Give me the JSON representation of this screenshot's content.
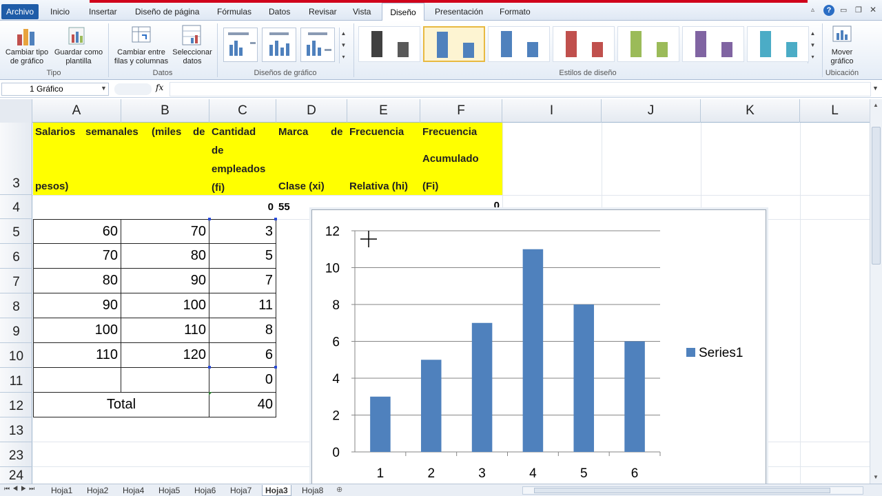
{
  "menu": {
    "archivo": "Archivo",
    "items": [
      "Inicio",
      "Insertar",
      "Diseño de página",
      "Fórmulas",
      "Datos",
      "Revisar",
      "Vista"
    ],
    "active": "Diseño",
    "after": [
      "Presentación",
      "Formato"
    ]
  },
  "ribbon": {
    "tipo": {
      "btn1": "Cambiar tipo de gráfico",
      "btn2": "Guardar como plantilla",
      "label": "Tipo"
    },
    "datos": {
      "btn1": "Cambiar entre filas y columnas",
      "btn2": "Seleccionar datos",
      "label": "Datos"
    },
    "disenos_label": "Diseños de gráfico",
    "estilos_label": "Estilos de diseño",
    "style_colors": [
      "#404040",
      "#4f81bd",
      "#4f81bd",
      "#c0504d",
      "#9bbb59",
      "#8064a2",
      "#4bacc6"
    ],
    "ubicacion": {
      "btn": "Mover gráfico",
      "label": "Ubicación"
    }
  },
  "formula": {
    "namebox": "1 Gráfico",
    "fx": "fx",
    "content": ""
  },
  "columns": [
    "A",
    "B",
    "C",
    "D",
    "E",
    "F",
    "I",
    "J",
    "K",
    "L"
  ],
  "rows": [
    "3",
    "4",
    "5",
    "6",
    "7",
    "8",
    "9",
    "10",
    "11",
    "12",
    "13",
    "23",
    "24"
  ],
  "headers": {
    "a_line1": "Salarios",
    "a_line1b": "semanales",
    "a_line1c": "(miles",
    "a_line1d": "de",
    "a_line2": "pesos)",
    "c_line1": "Cantidad",
    "c_line2": "de",
    "c_line3": "empleados",
    "c_line4": "(fi)",
    "d_line1": "Marca",
    "d_line1b": "de",
    "d_line2": "Clase (xi)",
    "e_line1": "Frecuencia",
    "e_line2": "Relativa (hi)",
    "f_line1": "Frecuencia",
    "f_line2": "Acumulado",
    "f_line3": "(Fi)"
  },
  "row4": {
    "c": "0",
    "d": "55",
    "f": "0"
  },
  "table": [
    {
      "a": "60",
      "b": "70",
      "c": "3"
    },
    {
      "a": "70",
      "b": "80",
      "c": "5"
    },
    {
      "a": "80",
      "b": "90",
      "c": "7"
    },
    {
      "a": "90",
      "b": "100",
      "c": "11"
    },
    {
      "a": "100",
      "b": "110",
      "c": "8"
    },
    {
      "a": "110",
      "b": "120",
      "c": "6"
    }
  ],
  "row11": {
    "c": "0"
  },
  "total": {
    "label": "Total",
    "value": "40"
  },
  "chart_data": {
    "type": "bar",
    "categories": [
      "1",
      "2",
      "3",
      "4",
      "5",
      "6"
    ],
    "series": [
      {
        "name": "Series1",
        "values": [
          3,
          5,
          7,
          11,
          8,
          6
        ],
        "color": "#4f81bd"
      }
    ],
    "ylim": [
      0,
      12
    ],
    "yticks": [
      "0",
      "2",
      "4",
      "6",
      "8",
      "10",
      "12"
    ],
    "grid": true,
    "legend": "right"
  },
  "sheets": [
    "Hoja1",
    "Hoja2",
    "Hoja4",
    "Hoja5",
    "Hoja6",
    "Hoja7",
    "Hoja3",
    "Hoja8"
  ],
  "active_sheet": "Hoja3"
}
